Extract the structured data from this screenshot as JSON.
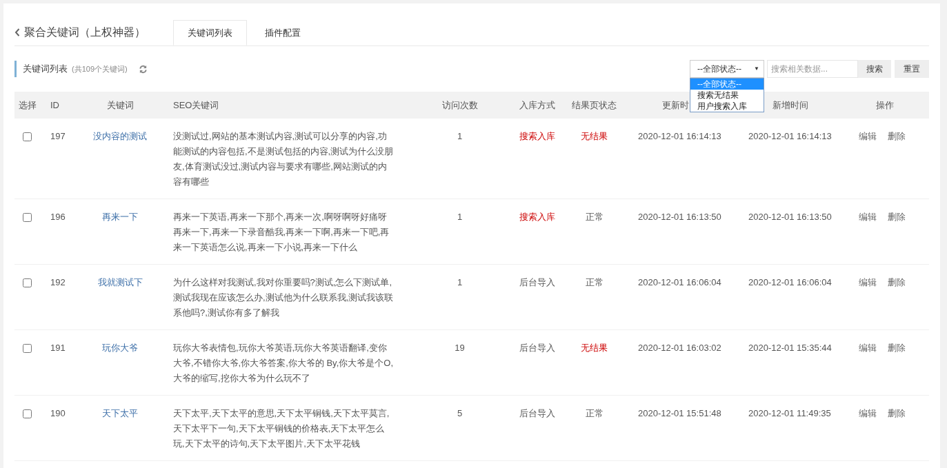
{
  "header": {
    "title": "聚合关键词（上权神器）",
    "tabs": [
      {
        "label": "关键词列表",
        "selected": true
      },
      {
        "label": "插件配置",
        "selected": false
      }
    ]
  },
  "toolbar": {
    "title": "关键词列表",
    "count": "(共109个关键词)",
    "status_select": {
      "value": "--全部状态--",
      "caret": "▼",
      "options": [
        {
          "label": "--全部状态--",
          "selected": true
        },
        {
          "label": "搜索无结果",
          "selected": false
        },
        {
          "label": "用户搜索入库",
          "selected": false
        }
      ]
    },
    "search": {
      "placeholder": "搜索相关数据..."
    },
    "buttons": [
      "搜索",
      "重置"
    ]
  },
  "table": {
    "columns": [
      "选择",
      "ID",
      "关键词",
      "SEO关键词",
      "访问次数",
      "入库方式",
      "结果页状态",
      "更新时",
      "新增时间",
      "操作"
    ],
    "rows": [
      {
        "checked": false,
        "id": "197",
        "keyword": "没内容的测试",
        "seo": "没测试过,网站的基本测试内容,测试可以分享的内容,功能测试的内容包括,不是测试包括的内容,测试为什么没朋友,体育测试没过,测试内容与要求有哪些,网站测试的内容有哪些",
        "visits": "1",
        "method": "搜索入库",
        "method_alert": true,
        "status": "无结果",
        "status_alert": true,
        "updated": "2020-12-01 16:14:13",
        "created": "2020-12-01 16:14:13",
        "actions": [
          "编辑",
          "删除"
        ]
      },
      {
        "checked": false,
        "id": "196",
        "keyword": "再来一下",
        "seo": "再来一下英语,再来一下那个,再来一次,啊呀啊呀好痛呀再来一下,再来一下录音酷我,再来一下啊,再来一下吧,再来一下英语怎么说,再来一下小说,再来一下什么",
        "visits": "1",
        "method": "搜索入库",
        "method_alert": true,
        "status": "正常",
        "status_alert": false,
        "updated": "2020-12-01 16:13:50",
        "created": "2020-12-01 16:13:50",
        "actions": [
          "编辑",
          "删除"
        ]
      },
      {
        "checked": false,
        "id": "192",
        "keyword": "我就测试下",
        "seo": "为什么这样对我测试,我对你重要吗?测试,怎么下测试单,测试我现在应该怎么办,测试他为什么联系我,测试我该联系他吗?,测试你有多了解我",
        "visits": "1",
        "method": "后台导入",
        "method_alert": false,
        "status": "正常",
        "status_alert": false,
        "updated": "2020-12-01 16:06:04",
        "created": "2020-12-01 16:06:04",
        "actions": [
          "编辑",
          "删除"
        ]
      },
      {
        "checked": false,
        "id": "191",
        "keyword": "玩你大爷",
        "seo": "玩你大爷表情包,玩你大爷英语,玩你大爷英语翻译,变你大爷,不错你大爷,你大爷答案,你大爷的 By,你大爷是个O,大爷的缩写,挖你大爷为什么玩不了",
        "visits": "19",
        "method": "后台导入",
        "method_alert": false,
        "status": "无结果",
        "status_alert": true,
        "updated": "2020-12-01 16:03:02",
        "created": "2020-12-01 15:35:44",
        "actions": [
          "编辑",
          "删除"
        ]
      },
      {
        "checked": false,
        "id": "190",
        "keyword": "天下太平",
        "seo": "天下太平,天下太平的意思,天下太平铜钱,天下太平莫言,天下太平下一句,天下太平铜钱的价格表,天下太平怎么玩,天下太平的诗句,天下太平图片,天下太平花钱",
        "visits": "5",
        "method": "后台导入",
        "method_alert": false,
        "status": "正常",
        "status_alert": false,
        "updated": "2020-12-01 15:51:48",
        "created": "2020-12-01 11:49:35",
        "actions": [
          "编辑",
          "删除"
        ]
      }
    ]
  }
}
